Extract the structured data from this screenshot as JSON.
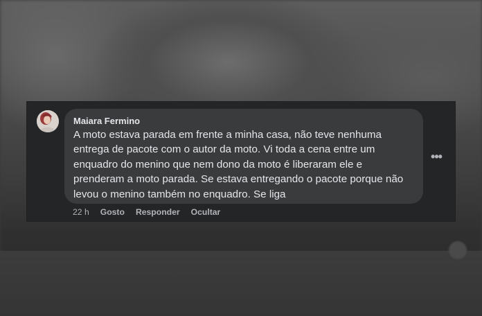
{
  "comment": {
    "author": "Maiara Fermino",
    "text": "A moto estava parada em frente a minha casa, não teve nenhuma\nentrega de pacote com o autor da moto. Vi toda a cena entre um\nenquadro do menino que nem dono da moto é liberaram ele e\nprenderam a moto parada. Se estava entregando o pacote porque não\nlevou o menino também no enquadro. Se liga",
    "time": "22 h",
    "actions": {
      "like": "Gosto",
      "reply": "Responder",
      "hide": "Ocultar"
    },
    "more_icon": "more-horizontal-icon"
  },
  "colors": {
    "panel_bg": "#242526",
    "bubble_bg": "#3a3b3c",
    "primary_text": "#e4e6eb",
    "secondary_text": "#b0b3b8"
  }
}
